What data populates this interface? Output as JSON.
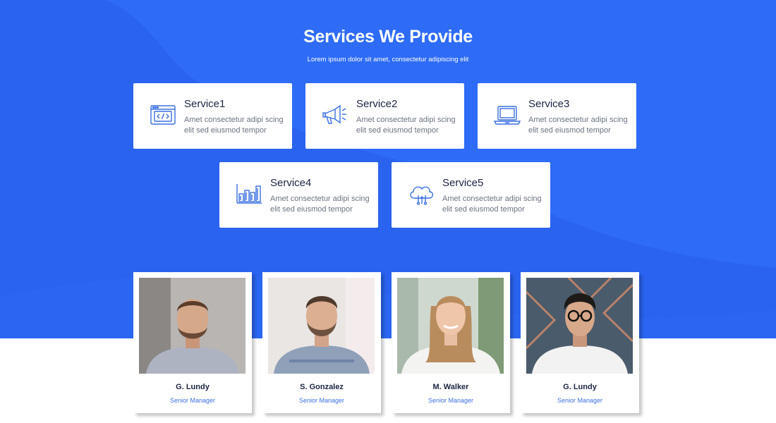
{
  "colors": {
    "brand": "#2e6bf6",
    "card": "#ffffff",
    "heading": "#1c2440",
    "role": "#3c6fe0"
  },
  "section": {
    "title": "Services We Provide",
    "subtitle": "Lorem ipsum dolor sit amet, consectetur adipiscing elit"
  },
  "services": [
    {
      "name": "Service1",
      "desc": "Amet consectetur adipi scing elit sed eiusmod tempor",
      "icon": "code-window-icon"
    },
    {
      "name": "Service2",
      "desc": "Amet consectetur adipi scing elit sed eiusmod tempor",
      "icon": "megaphone-icon"
    },
    {
      "name": "Service3",
      "desc": "Amet consectetur adipi scing elit sed eiusmod tempor",
      "icon": "laptop-icon"
    },
    {
      "name": "Service4",
      "desc": "Amet consectetur adipi scing elit sed eiusmod tempor",
      "icon": "bar-chart-icon"
    },
    {
      "name": "Service5",
      "desc": "Amet consectetur adipi scing elit sed eiusmod tempor",
      "icon": "cloud-icon"
    }
  ],
  "team": [
    {
      "name": "G. Lundy",
      "role": "Senior Manager"
    },
    {
      "name": "S. Gonzalez",
      "role": "Senior Manager"
    },
    {
      "name": "M. Walker",
      "role": "Senior Manager"
    },
    {
      "name": "G. Lundy",
      "role": "Senior Manager"
    }
  ]
}
